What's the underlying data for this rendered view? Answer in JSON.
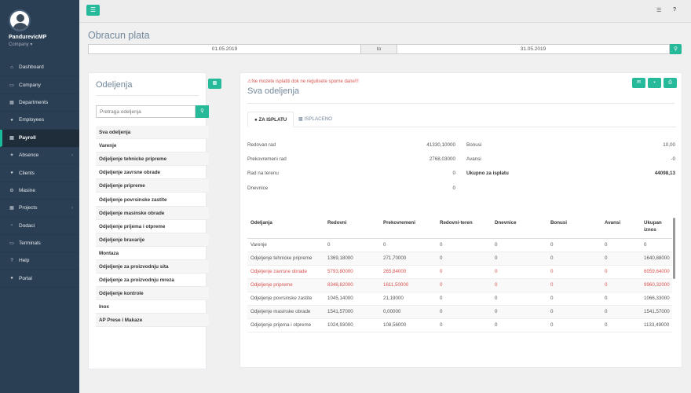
{
  "user": {
    "name": "PandurevicMP",
    "company": "Company ▾"
  },
  "nav": [
    {
      "label": "Dashboard",
      "icon": "⌂"
    },
    {
      "label": "Company",
      "icon": "▭"
    },
    {
      "label": "Departments",
      "icon": "▦"
    },
    {
      "label": "Employees",
      "icon": "●"
    },
    {
      "label": "Payroll",
      "icon": "▤"
    },
    {
      "label": "Absence",
      "icon": "✦"
    },
    {
      "label": "Clients",
      "icon": "●"
    },
    {
      "label": "Masine",
      "icon": "⚙"
    },
    {
      "label": "Projects",
      "icon": "▦"
    },
    {
      "label": "Dodaci",
      "icon": "▫"
    },
    {
      "label": "Terminals",
      "icon": "▭"
    },
    {
      "label": "Help",
      "icon": "?"
    },
    {
      "label": "Portal",
      "icon": "●"
    }
  ],
  "page": {
    "title": "Obracun plata",
    "date_from": "01.05.2019",
    "to": "to",
    "date_to": "31.05.2019"
  },
  "left": {
    "title": "Odeljenja",
    "search_placeholder": "Pretraga odeljenja",
    "depts": [
      "Sva odeljenja",
      "Varenje",
      "Odjeljenje tehnicke pripreme",
      "Odjeljenje zavrsne obrade",
      "Odjeljenje pripreme",
      "Odjeljenje povrsinske zastite",
      "Odjeljenje masinske obrade",
      "Odjeljenje prijema i otpreme",
      "Odjeljenje bravarije",
      "Montaza",
      "Odjeljenje za proizvodnju sita",
      "Odjeljenje za proizvodnju mreza",
      "Odjeljenje kontrole",
      "Inox",
      "AP Prese i Makaze"
    ]
  },
  "right": {
    "warning": "Ne mozete isplatiti dok ne regulisete sporne dane!!!",
    "title": "Sva odeljenja",
    "tab1": "ZA ISPLATU",
    "tab2": "ISPLACENO",
    "sum": {
      "redovan_l": "Redovan rad",
      "redovan_v": "41330,10000",
      "prek_l": "Prekovremeni rad",
      "prek_v": "2768,03000",
      "teren_l": "Rad na terenu",
      "teren_v": "0",
      "dnev_l": "Dnevnice",
      "dnev_v": "0",
      "bonusi_l": "Bonusi",
      "bonusi_v": "10,00",
      "avansi_l": "Avansi",
      "avansi_v": "-0",
      "ukupno_l": "Ukupno za isplatu",
      "ukupno_v": "44098,13"
    },
    "headers": [
      "Odeljanja",
      "Redovni",
      "Prekovremeni",
      "Redovni-teren",
      "Dnevnice",
      "Bonusi",
      "Avansi",
      "Ukupan iznos"
    ],
    "rows": [
      [
        "Varenje",
        "0",
        "0",
        "0",
        "0",
        "0",
        "0",
        "0"
      ],
      [
        "Odjeljenje tehnicke pripreme",
        "1369,18000",
        "271,70000",
        "0",
        "0",
        "0",
        "0",
        "1640,88000"
      ],
      [
        "Odjeljenje zavrsne obrade",
        "5793,80000",
        "265,84000",
        "0",
        "0",
        "0",
        "0",
        "6059,64000"
      ],
      [
        "Odjeljenje pripreme",
        "8348,82000",
        "1611,50000",
        "0",
        "0",
        "0",
        "0",
        "9960,32000"
      ],
      [
        "Odjeljenje povrsinske zastite",
        "1045,14000",
        "21,19000",
        "0",
        "0",
        "0",
        "0",
        "1066,33000"
      ],
      [
        "Odjeljenje masinske obrade",
        "1541,57000",
        "0,00000",
        "0",
        "0",
        "0",
        "0",
        "1541,57000"
      ],
      [
        "Odjeljenje prijema i otpreme",
        "1024,93000",
        "108,56000",
        "0",
        "0",
        "0",
        "0",
        "1133,49000"
      ]
    ],
    "red_rows": [
      2,
      3
    ]
  }
}
